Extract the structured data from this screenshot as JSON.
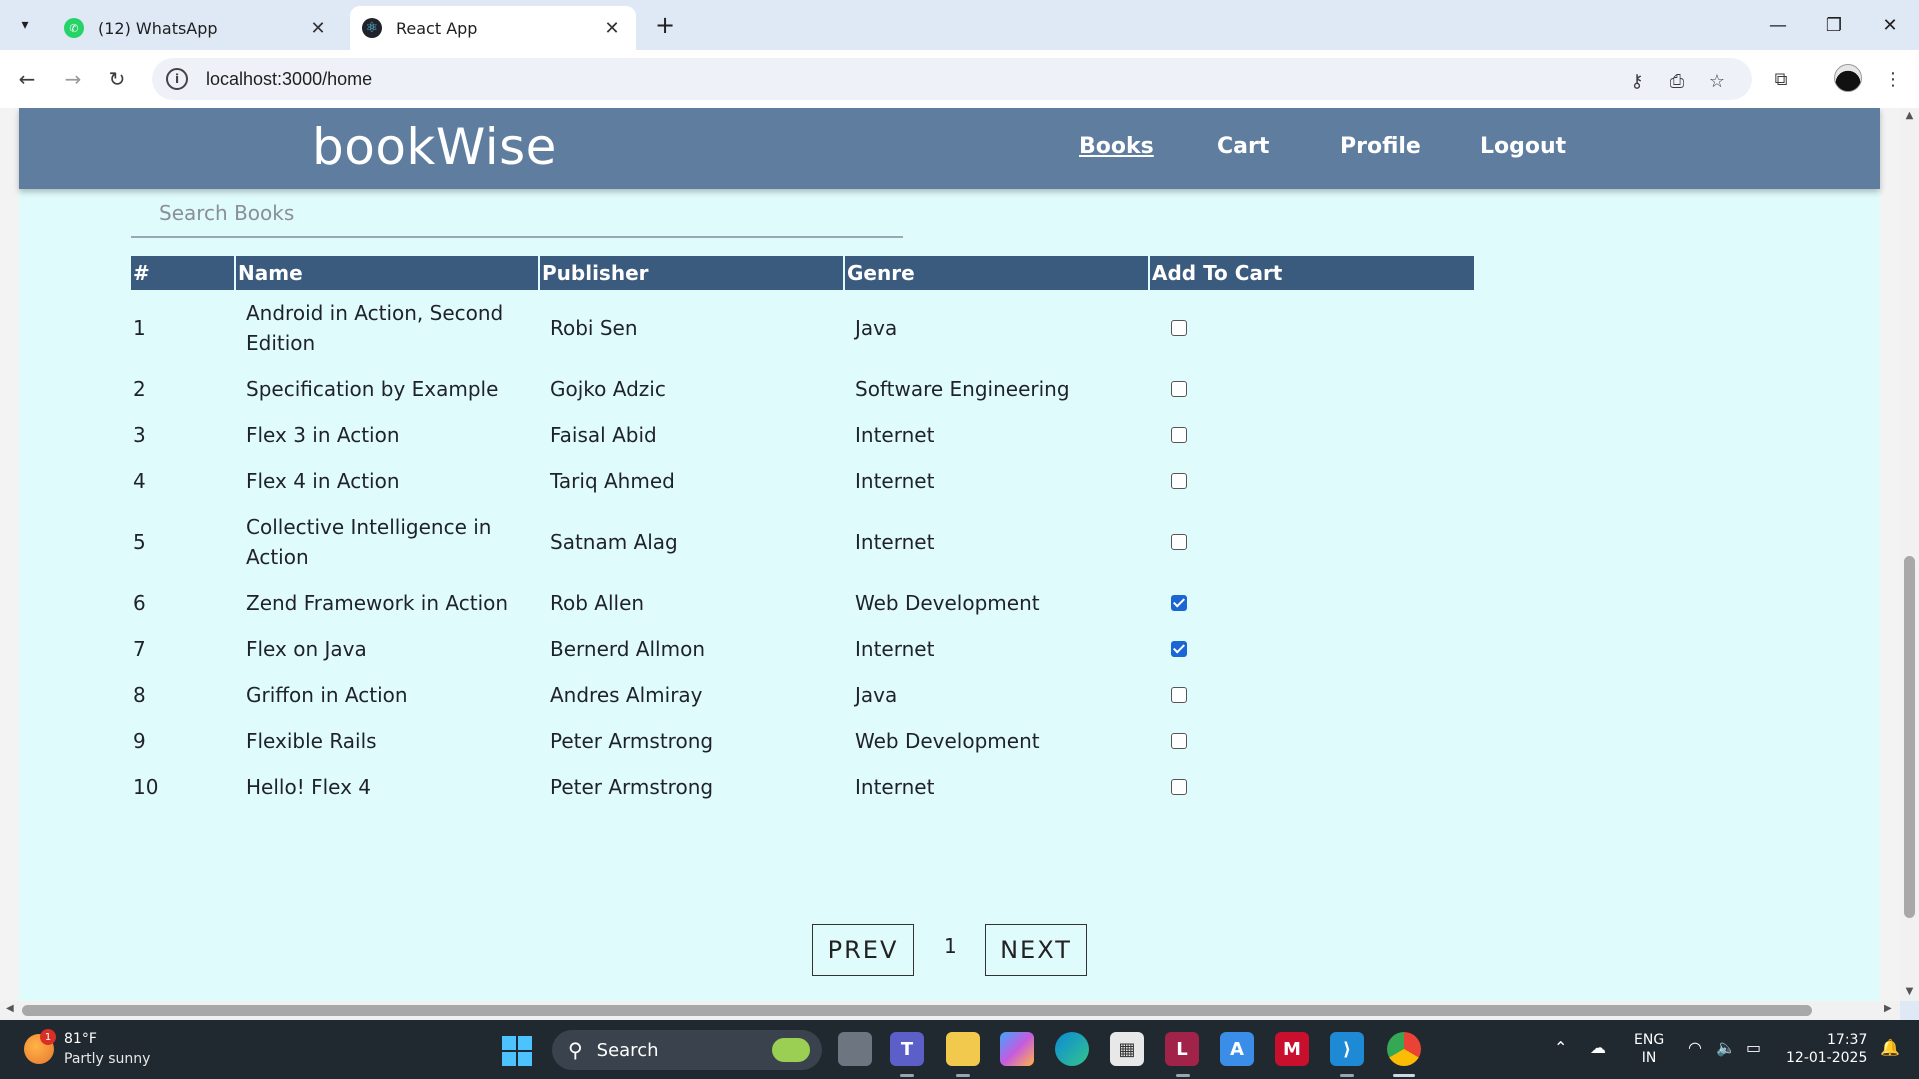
{
  "browser": {
    "tabs": [
      {
        "title": "(12) WhatsApp",
        "active": false,
        "icon": "whatsapp-icon"
      },
      {
        "title": "React App",
        "active": true,
        "icon": "react-icon"
      }
    ],
    "url": "localhost:3000/home"
  },
  "app": {
    "brand": "bookWise",
    "nav": [
      {
        "label": "Books",
        "active": true
      },
      {
        "label": "Cart",
        "active": false
      },
      {
        "label": "Profile",
        "active": false
      },
      {
        "label": "Logout",
        "active": false
      }
    ],
    "search_placeholder": "Search Books",
    "table": {
      "headers": [
        "#",
        "Name",
        "Publisher",
        "Genre",
        "Add To Cart"
      ],
      "rows": [
        {
          "num": "1",
          "name": "Android in Action, Second Edition",
          "publisher": "Robi Sen",
          "genre": "Java",
          "in_cart": false
        },
        {
          "num": "2",
          "name": "Specification by Example",
          "publisher": "Gojko Adzic",
          "genre": "Software Engineering",
          "in_cart": false
        },
        {
          "num": "3",
          "name": "Flex 3 in Action",
          "publisher": "Faisal Abid",
          "genre": "Internet",
          "in_cart": false
        },
        {
          "num": "4",
          "name": "Flex 4 in Action",
          "publisher": "Tariq Ahmed",
          "genre": "Internet",
          "in_cart": false
        },
        {
          "num": "5",
          "name": "Collective Intelligence in Action",
          "publisher": "Satnam Alag",
          "genre": "Internet",
          "in_cart": false
        },
        {
          "num": "6",
          "name": "Zend Framework in Action",
          "publisher": "Rob Allen",
          "genre": "Web Development",
          "in_cart": true
        },
        {
          "num": "7",
          "name": "Flex on Java",
          "publisher": "Bernerd Allmon",
          "genre": "Internet",
          "in_cart": true
        },
        {
          "num": "8",
          "name": "Griffon in Action",
          "publisher": "Andres Almiray",
          "genre": "Java",
          "in_cart": false
        },
        {
          "num": "9",
          "name": "Flexible Rails",
          "publisher": "Peter Armstrong",
          "genre": "Web Development",
          "in_cart": false
        },
        {
          "num": "10",
          "name": "Hello! Flex 4",
          "publisher": "Peter Armstrong",
          "genre": "Internet",
          "in_cart": false
        }
      ]
    },
    "pagination": {
      "prev_label": "PREV",
      "page": "1",
      "next_label": "NEXT"
    }
  },
  "taskbar": {
    "weather_temp": "81°F",
    "weather_desc": "Partly sunny",
    "weather_badge": "1",
    "search_label": "Search",
    "lang_line1": "ENG",
    "lang_line2": "IN",
    "time": "17:37",
    "date": "12-01-2025",
    "apps": [
      "task-view-icon",
      "teams-icon",
      "file-explorer-icon",
      "copilot-icon",
      "edge-icon",
      "store-icon",
      "launcher-l-icon",
      "azure-icon",
      "mcafee-icon",
      "vscode-icon",
      "chrome-icon"
    ]
  },
  "colors": {
    "page_bg": "#e0fbfc",
    "navbar_bg": "#5f7d9e",
    "table_header_bg": "#3b5b7e",
    "checkbox_checked": "#1a66d2"
  }
}
